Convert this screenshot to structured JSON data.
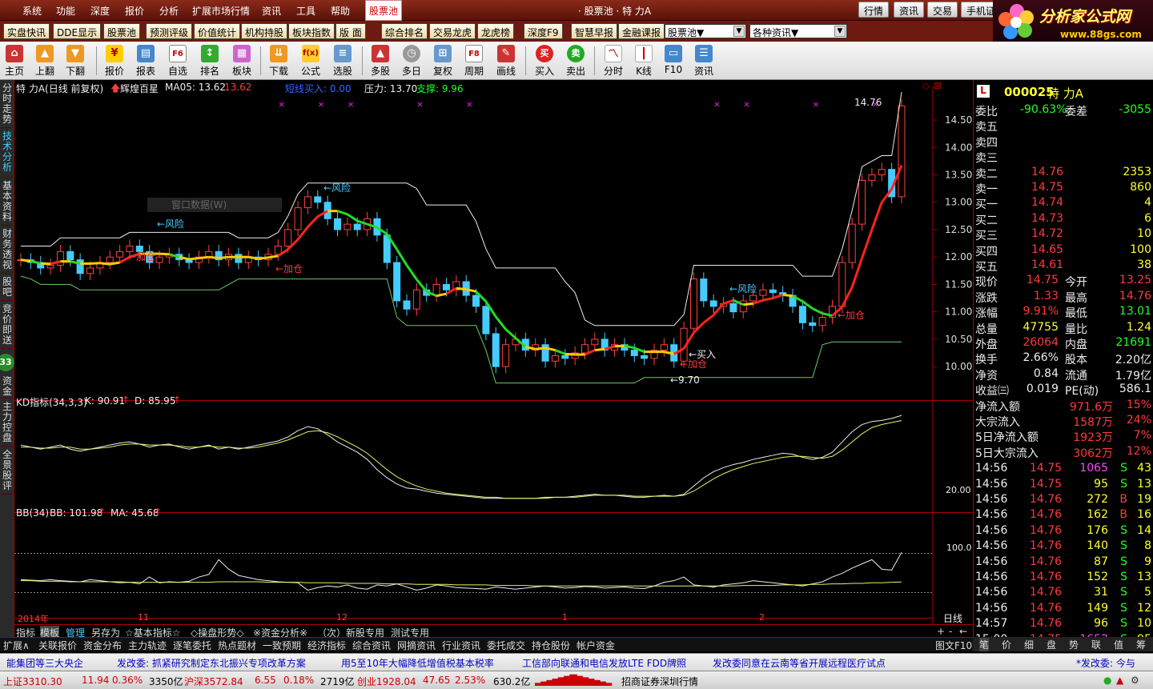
{
  "menu": {
    "items": [
      "系统",
      "功能",
      "深度",
      "报价",
      "分析",
      "扩展市场行情",
      "资讯",
      "工具",
      "帮助",
      "股票池"
    ],
    "title": "· 股票池 · 特 力A",
    "tabs": [
      "行情",
      "资讯",
      "交易",
      "手机证"
    ]
  },
  "logo": {
    "title": "分析家公式网",
    "site": "www.88gs.com"
  },
  "quickbar": {
    "buttons": [
      "实盘快讯",
      "DDE显示",
      "股票池",
      "预测评级",
      "价值统计",
      "机构持股",
      "板块指数",
      "版 面",
      "综合排名",
      "交易龙虎",
      "龙虎榜",
      "深度F9",
      "智慧早报",
      "金融课报"
    ],
    "select1": "股票池▼",
    "select2": "各种资讯▼"
  },
  "toolbar": {
    "buttons": [
      "主页",
      "上翻",
      "下翻",
      "报价",
      "报表",
      "自选",
      "排名",
      "板块",
      "下载",
      "公式",
      "选股",
      "多股",
      "多日",
      "复权",
      "周期",
      "画线",
      "买入",
      "卖出",
      "分时",
      "K线",
      "F10",
      "资讯"
    ]
  },
  "lefttabs": [
    "分时走势",
    "技术分析",
    "基本资料",
    "财务透视",
    "股吧",
    "竞价即送",
    "资金",
    "主力控盘",
    "全景股评"
  ],
  "badge": "33",
  "chart": {
    "header": {
      "name": "特 力A(日线 前复权)",
      "formula": "辉煌百星",
      "ma": "MA05: 13.62",
      "ma_val": "13.62",
      "buy": "短线买入: 0.00",
      "pressure": "压力: 13.70",
      "support": "支撑: 9.96"
    },
    "annotations": {
      "risk": "←风险",
      "add": "←加仓",
      "buy_in": "←买入",
      "high": "14.76",
      "low": "←9.70",
      "window": "窗口数据(W)"
    },
    "price_axis": [
      "14.50",
      "14.00",
      "13.50",
      "13.00",
      "12.50",
      "12.00",
      "11.50",
      "11.00",
      "10.50",
      "10.00"
    ],
    "kd": {
      "label": "KD指标(34,3,3)",
      "k": "K: 90.91",
      "d": "D: 85.95",
      "axis": "20.00"
    },
    "bb": {
      "label": "BB(34)",
      "bb": "BB: 101.98",
      "ma": "MA: 45.68",
      "axis": "100.0"
    },
    "dates": [
      "2014年",
      "11",
      "12",
      "1",
      "2"
    ],
    "period": "日线"
  },
  "chart_data": {
    "type": "line",
    "title": "特 力A(日线 前复权)",
    "ylim": [
      9.6,
      14.8
    ],
    "close": [
      11.95,
      11.9,
      11.8,
      11.85,
      12.1,
      11.95,
      11.7,
      11.8,
      11.9,
      12.0,
      12.1,
      12.2,
      12.1,
      11.9,
      12.0,
      12.05,
      11.95,
      11.9,
      12.0,
      12.1,
      11.95,
      12.05,
      11.9,
      12.0,
      11.95,
      12.05,
      12.2,
      12.5,
      12.9,
      13.1,
      13.0,
      12.7,
      12.5,
      12.6,
      12.5,
      12.7,
      12.4,
      11.9,
      11.2,
      11.05,
      11.4,
      11.3,
      11.5,
      11.4,
      11.55,
      11.3,
      11.1,
      10.6,
      10.0,
      10.4,
      10.5,
      10.3,
      10.4,
      10.1,
      10.2,
      10.15,
      10.25,
      10.4,
      10.5,
      10.3,
      10.4,
      10.3,
      10.2,
      10.15,
      10.3,
      10.4,
      10.1,
      10.7,
      11.6,
      11.2,
      11.1,
      11.15,
      11.0,
      11.2,
      11.3,
      11.4,
      11.35,
      11.3,
      11.1,
      10.8,
      10.75,
      10.9,
      11.1,
      11.9,
      12.6,
      13.4,
      13.5,
      13.6,
      13.1,
      14.76
    ],
    "kd_k": [
      62,
      60,
      58,
      60,
      62,
      58,
      56,
      58,
      60,
      62,
      64,
      65,
      63,
      60,
      62,
      63,
      60,
      58,
      60,
      62,
      58,
      60,
      58,
      60,
      62,
      64,
      66,
      70,
      76,
      80,
      78,
      72,
      65,
      60,
      55,
      48,
      38,
      30,
      24,
      20,
      19,
      17,
      15,
      14,
      13,
      12,
      11,
      10,
      10,
      10,
      10,
      10,
      10,
      11,
      11,
      11,
      12,
      13,
      14,
      13,
      13,
      12,
      11,
      11,
      12,
      13,
      12,
      14,
      22,
      30,
      36,
      40,
      43,
      45,
      48,
      50,
      52,
      54,
      53,
      50,
      48,
      50,
      55,
      65,
      75,
      82,
      85,
      86,
      88,
      90.91
    ],
    "kd_d": [
      60,
      60,
      59,
      59,
      60,
      60,
      58,
      58,
      59,
      60,
      62,
      63,
      63,
      62,
      62,
      62,
      61,
      60,
      60,
      61,
      60,
      60,
      59,
      59,
      60,
      62,
      64,
      67,
      71,
      75,
      76,
      74,
      70,
      65,
      60,
      54,
      46,
      38,
      31,
      26,
      22,
      19,
      17,
      15,
      14,
      13,
      12,
      11,
      11,
      10,
      10,
      10,
      10,
      10,
      11,
      11,
      11,
      12,
      13,
      13,
      13,
      13,
      12,
      12,
      12,
      12,
      12,
      13,
      17,
      23,
      29,
      34,
      38,
      41,
      44,
      46,
      48,
      50,
      51,
      51,
      50,
      49,
      51,
      57,
      65,
      73,
      79,
      82,
      84,
      85.95
    ],
    "bb": [
      50,
      49,
      48,
      50,
      48,
      47,
      46,
      50,
      48,
      46,
      44,
      45,
      42,
      55,
      44,
      46,
      45,
      47,
      55,
      60,
      88,
      70,
      58,
      54,
      50,
      48,
      46,
      45,
      44,
      30,
      35,
      38,
      36,
      40,
      34,
      32,
      40,
      38,
      42,
      36,
      30,
      34,
      40,
      38,
      35,
      34,
      33,
      32,
      36,
      34,
      32,
      34,
      36,
      38,
      36,
      34,
      35,
      37,
      36,
      34,
      35,
      36,
      34,
      33,
      38,
      45,
      48,
      55,
      40,
      38,
      36,
      40,
      42,
      44,
      48,
      46,
      44,
      42,
      40,
      38,
      42,
      46,
      55,
      62,
      72,
      80,
      88,
      70,
      68,
      101.98
    ],
    "bb_ma": [
      48,
      48,
      47,
      47,
      47,
      46,
      46,
      46,
      46,
      46,
      46,
      45,
      45,
      45,
      45,
      45,
      45,
      45,
      45,
      45,
      46,
      46,
      46,
      46,
      46,
      45,
      45,
      45,
      45,
      44,
      44,
      44,
      44,
      43,
      43,
      43,
      43,
      42,
      42,
      42,
      41,
      41,
      41,
      41,
      40,
      40,
      40,
      40,
      39,
      39,
      39,
      39,
      38,
      38,
      38,
      38,
      38,
      38,
      38,
      38,
      38,
      38,
      38,
      38,
      38,
      38,
      38,
      38,
      38,
      38,
      38,
      38,
      38,
      39,
      39,
      39,
      39,
      40,
      40,
      40,
      41,
      41,
      42,
      42,
      43,
      43,
      44,
      44,
      45,
      45.68
    ]
  },
  "right": {
    "code": "000025",
    "name": "特 力A",
    "weibi": [
      "委比",
      "-90.63%",
      "委差",
      "-3055"
    ],
    "sell": [
      [
        "卖五",
        "",
        ""
      ],
      [
        "卖四",
        "",
        ""
      ],
      [
        "卖三",
        "",
        ""
      ],
      [
        "卖二",
        "14.76",
        "2353"
      ],
      [
        "卖一",
        "14.75",
        "860"
      ]
    ],
    "buy": [
      [
        "买一",
        "14.74",
        "4"
      ],
      [
        "买二",
        "14.73",
        "6"
      ],
      [
        "买三",
        "14.72",
        "10"
      ],
      [
        "买四",
        "14.65",
        "100"
      ],
      [
        "买五",
        "14.61",
        "38"
      ]
    ],
    "info": [
      [
        "现价",
        "14.75",
        "今开",
        "13.25"
      ],
      [
        "涨跌",
        "1.33",
        "最高",
        "14.76"
      ],
      [
        "涨幅",
        "9.91%",
        "最低",
        "13.01"
      ],
      [
        "总量",
        "47755",
        "量比",
        "1.24"
      ],
      [
        "外盘",
        "26064",
        "内盘",
        "21691"
      ],
      [
        "换手",
        "2.66%",
        "股本",
        "2.20亿"
      ],
      [
        "净资",
        "0.84",
        "流通",
        "1.79亿"
      ],
      [
        "收益㈢",
        "0.019",
        "PE(动)",
        "586.1"
      ]
    ],
    "flow": [
      [
        "净流入额",
        "971.6万",
        "15%"
      ],
      [
        "大宗流入",
        "1587万",
        "24%"
      ],
      [
        "5日净流入额",
        "1923万",
        "7%"
      ],
      [
        "5日大宗流入",
        "3062万",
        "12%"
      ]
    ],
    "ticks": [
      [
        "14:56",
        "14.75",
        "1065",
        "S",
        "43"
      ],
      [
        "14:56",
        "14.75",
        "95",
        "S",
        "13"
      ],
      [
        "14:56",
        "14.76",
        "272",
        "B",
        "19"
      ],
      [
        "14:56",
        "14.76",
        "162",
        "B",
        "16"
      ],
      [
        "14:56",
        "14.76",
        "176",
        "S",
        "14"
      ],
      [
        "14:56",
        "14.76",
        "140",
        "S",
        "8"
      ],
      [
        "14:56",
        "14.76",
        "87",
        "S",
        "9"
      ],
      [
        "14:56",
        "14.76",
        "152",
        "S",
        "13"
      ],
      [
        "14:56",
        "14.76",
        "31",
        "S",
        "5"
      ],
      [
        "14:56",
        "14.76",
        "149",
        "S",
        "12"
      ],
      [
        "14:57",
        "14.76",
        "96",
        "S",
        "10"
      ],
      [
        "15:00",
        "14.75",
        "1652",
        "S",
        "95"
      ]
    ],
    "btabs": [
      "笔",
      "价",
      "细",
      "盘",
      "势",
      "联",
      "值",
      "筹"
    ]
  },
  "bottomtabs": [
    "指标",
    "模板",
    "管理",
    "另存为",
    "☆基本指标☆",
    "◇操盘形势◇",
    "※资金分析※",
    "（次）新股专用",
    "测试专用"
  ],
  "funcbar": [
    "扩展∧",
    "关联报价",
    "资金分布",
    "主力轨迹",
    "逐笔委托",
    "热点题材",
    "一致预期",
    "经济指标",
    "综合资讯",
    "网摘资讯",
    "行业资讯",
    "委托成交",
    "持仓股份",
    "帐户资金",
    "图文F10"
  ],
  "news": [
    "能集团等三大央企",
    "发改委: 抓紧研究制定东北振兴专项改革方案",
    "用5至10年大幅降低增值税基本税率",
    "工信部向联通和电信发放LTE FDD牌照",
    "发改委同意在云南等省开展远程医疗试点",
    "*发改委: 今与"
  ],
  "status": {
    "sh": "上证3310.30",
    "sh_chg": "11.94",
    "sh_pct": "0.36%",
    "sh_amt": "3350亿",
    "sz": "沪深3572.84",
    "sz_chg": "6.55",
    "sz_pct": "0.18%",
    "sz_amt": "2719亿",
    "cy": "创业1928.04",
    "cy_chg": "47.65",
    "cy_pct": "2.53%",
    "cy_amt": "630.2亿",
    "broker": "招商证券深圳行情"
  }
}
